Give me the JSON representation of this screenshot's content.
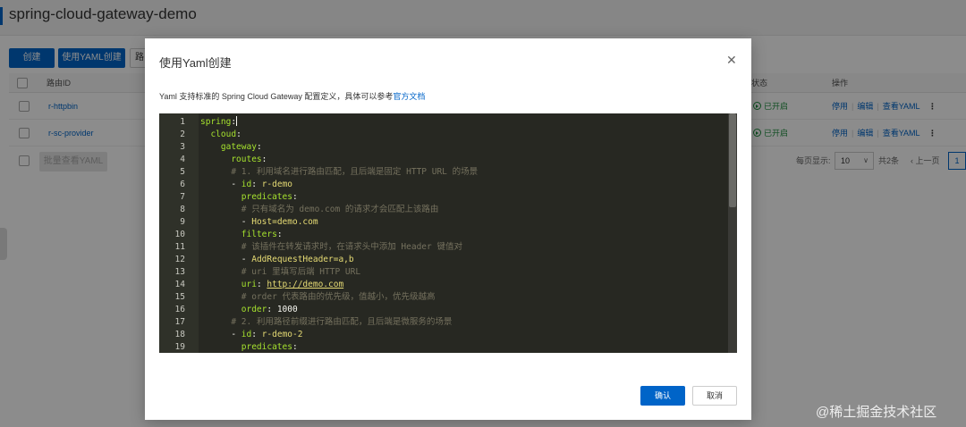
{
  "page": {
    "title": "spring-cloud-gateway-demo",
    "toolbar": {
      "create_label": "创建",
      "create_yaml_label": "使用YAML创建",
      "third_label": "路"
    },
    "table": {
      "col_route_id": "路由ID",
      "col_status": "状态",
      "col_actions": "操作",
      "rows": [
        {
          "route_id": "r-httpbin",
          "status": "已开启",
          "action_stop": "停用",
          "action_edit": "编辑",
          "action_yaml": "查看YAML",
          "more": "⋮"
        },
        {
          "route_id": "r-sc-provider",
          "status": "已开启",
          "action_stop": "停用",
          "action_edit": "编辑",
          "action_yaml": "查看YAML",
          "more": "⋮"
        }
      ],
      "batch_yaml_label": "批量查看YAML"
    },
    "pager": {
      "per_page_label": "每页显示:",
      "per_page_value": "10",
      "total_label": "共2条",
      "prev_label": "上一页",
      "current_page": "1"
    }
  },
  "modal": {
    "title": "使用Yaml创建",
    "close_icon": "close-icon",
    "desc_prefix": "Yaml 支持标准的 Spring Cloud Gateway 配置定义，具体可以参考",
    "desc_link": "官方文档",
    "confirm_label": "确认",
    "cancel_label": "取消",
    "code_lines": [
      {
        "num": "1",
        "indent": "",
        "parts": [
          {
            "t": "spring",
            "c": "k"
          },
          {
            "t": ":",
            "c": "n"
          }
        ],
        "cursor": true
      },
      {
        "num": "2",
        "indent": "  ",
        "parts": [
          {
            "t": "cloud",
            "c": "k"
          },
          {
            "t": ":",
            "c": "n"
          }
        ]
      },
      {
        "num": "3",
        "indent": "    ",
        "parts": [
          {
            "t": "gateway",
            "c": "k"
          },
          {
            "t": ":",
            "c": "n"
          }
        ]
      },
      {
        "num": "4",
        "indent": "      ",
        "parts": [
          {
            "t": "routes",
            "c": "k"
          },
          {
            "t": ":",
            "c": "n"
          }
        ]
      },
      {
        "num": "5",
        "indent": "      ",
        "parts": [
          {
            "t": "# 1. 利用域名进行路由匹配，且后端是固定 HTTP URL 的场景",
            "c": "c"
          }
        ]
      },
      {
        "num": "6",
        "indent": "      ",
        "parts": [
          {
            "t": "- ",
            "c": "n"
          },
          {
            "t": "id",
            "c": "k"
          },
          {
            "t": ": ",
            "c": "n"
          },
          {
            "t": "r-demo",
            "c": "s"
          }
        ]
      },
      {
        "num": "7",
        "indent": "        ",
        "parts": [
          {
            "t": "predicates",
            "c": "k"
          },
          {
            "t": ":",
            "c": "n"
          }
        ]
      },
      {
        "num": "8",
        "indent": "        ",
        "parts": [
          {
            "t": "# 只有域名为 demo.com 的请求才会匹配上该路由",
            "c": "c"
          }
        ]
      },
      {
        "num": "9",
        "indent": "        ",
        "parts": [
          {
            "t": "- ",
            "c": "n"
          },
          {
            "t": "Host=demo.com",
            "c": "s"
          }
        ]
      },
      {
        "num": "10",
        "indent": "        ",
        "parts": [
          {
            "t": "filters",
            "c": "k"
          },
          {
            "t": ":",
            "c": "n"
          }
        ]
      },
      {
        "num": "11",
        "indent": "        ",
        "parts": [
          {
            "t": "# 该插件在转发请求时，在请求头中添加 Header 键值对",
            "c": "c"
          }
        ]
      },
      {
        "num": "12",
        "indent": "        ",
        "parts": [
          {
            "t": "- ",
            "c": "n"
          },
          {
            "t": "AddRequestHeader=a,b",
            "c": "s"
          }
        ]
      },
      {
        "num": "13",
        "indent": "        ",
        "parts": [
          {
            "t": "# uri 里填写后端 HTTP URL",
            "c": "c"
          }
        ]
      },
      {
        "num": "14",
        "indent": "        ",
        "parts": [
          {
            "t": "uri",
            "c": "k"
          },
          {
            "t": ": ",
            "c": "n"
          },
          {
            "t": "http://demo.com",
            "c": "u"
          }
        ]
      },
      {
        "num": "15",
        "indent": "        ",
        "parts": [
          {
            "t": "# order 代表路由的优先级，值越小，优先级越高",
            "c": "c"
          }
        ]
      },
      {
        "num": "16",
        "indent": "        ",
        "parts": [
          {
            "t": "order",
            "c": "k"
          },
          {
            "t": ": 1000",
            "c": "n"
          }
        ]
      },
      {
        "num": "17",
        "indent": "      ",
        "parts": [
          {
            "t": "# 2. 利用路径前缀进行路由匹配，且后端是微服务的场景",
            "c": "c"
          }
        ]
      },
      {
        "num": "18",
        "indent": "      ",
        "parts": [
          {
            "t": "- ",
            "c": "n"
          },
          {
            "t": "id",
            "c": "k"
          },
          {
            "t": ": ",
            "c": "n"
          },
          {
            "t": "r-demo-2",
            "c": "s"
          }
        ]
      },
      {
        "num": "19",
        "indent": "        ",
        "parts": [
          {
            "t": "predicates",
            "c": "k"
          },
          {
            "t": ":",
            "c": "n"
          }
        ]
      }
    ]
  },
  "watermark": "@稀土掘金技术社区"
}
